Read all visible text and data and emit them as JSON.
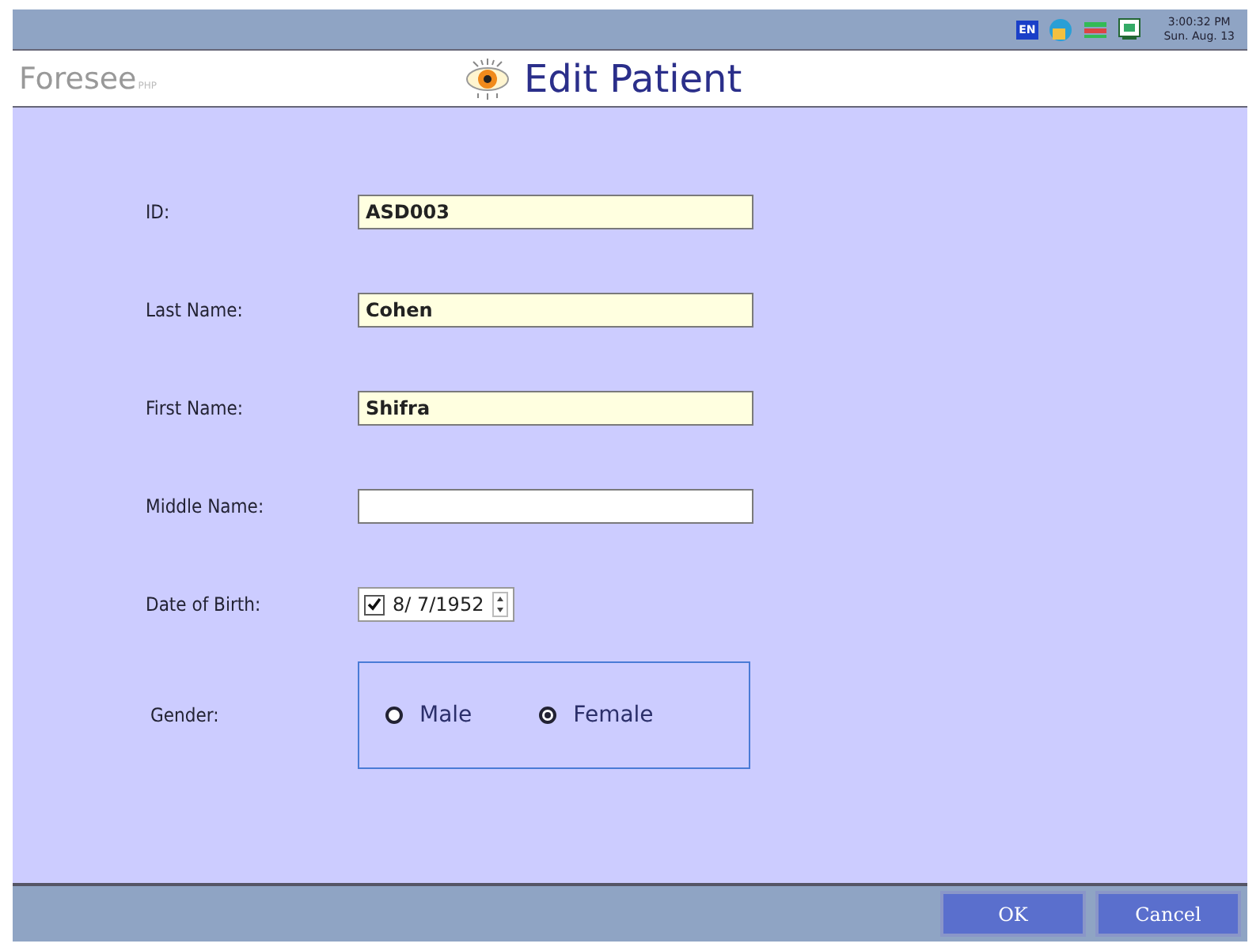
{
  "tray": {
    "language": "EN",
    "time": "3:00:32 PM",
    "date": "Sun. Aug. 13"
  },
  "header": {
    "logo": "Foresee",
    "logo_suffix": "PHP",
    "title": "Edit Patient"
  },
  "fields": [
    {
      "kind": "text",
      "label": "ID:",
      "value": "ASD003",
      "filled": true
    },
    {
      "kind": "text",
      "label": "Last Name:",
      "value": "Cohen",
      "filled": true
    },
    {
      "kind": "text",
      "label": "First Name:",
      "value": "Shifra",
      "filled": true
    },
    {
      "kind": "text",
      "label": "Middle Name:",
      "filled": false
    },
    {
      "kind": "date",
      "label": "Date of Birth:",
      "value": "8/ 7/1952",
      "checked": true
    },
    {
      "kind": "radio",
      "label": "Gender:",
      "options": [
        {
          "label": "Male",
          "selected": false
        },
        {
          "label": "Female",
          "selected": true
        }
      ]
    }
  ],
  "buttons": [
    "OK",
    "Cancel"
  ]
}
